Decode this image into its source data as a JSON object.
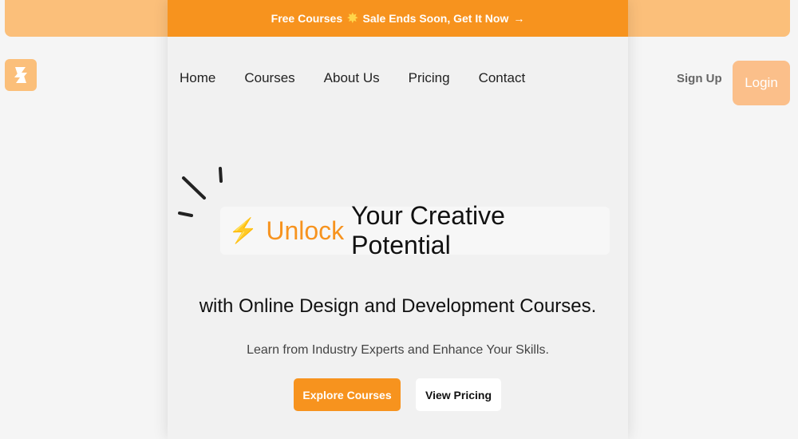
{
  "banner": {
    "left_text": "Free Courses",
    "right_text": "Sale Ends Soon, Get It Now",
    "arrow": "→"
  },
  "nav": {
    "items": [
      {
        "label": "Home"
      },
      {
        "label": "Courses"
      },
      {
        "label": "About Us"
      },
      {
        "label": "Pricing"
      },
      {
        "label": "Contact"
      }
    ]
  },
  "auth": {
    "signup_label": "Sign Up",
    "login_label": "Login"
  },
  "hero": {
    "bolt_icon": "⚡",
    "accent_word": "Unlock",
    "headline_rest": "Your Creative Potential",
    "subhead": "with Online Design and Development Courses.",
    "lead": "Learn from Industry Experts and Enhance Your Skills."
  },
  "cta": {
    "explore_label": "Explore Courses",
    "pricing_label": "View Pricing"
  },
  "colors": {
    "accent": "#f7931e",
    "accent_light": "#fbbf7a"
  }
}
